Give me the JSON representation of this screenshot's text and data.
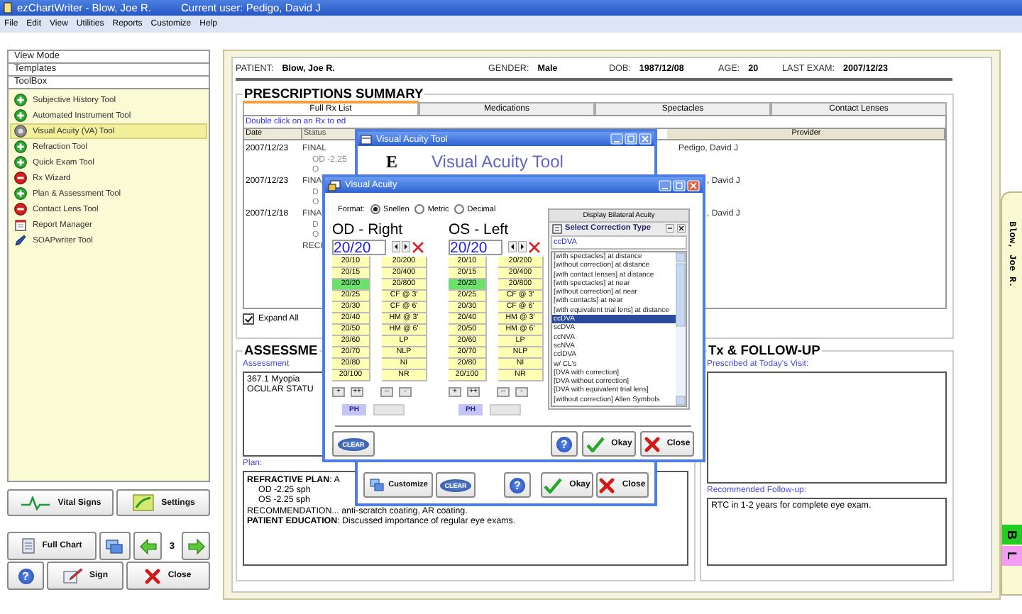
{
  "window": {
    "title": "ezChartWriter - Blow, Joe R.",
    "user": "Current user: Pedigo, David J"
  },
  "menu": [
    "File",
    "Edit",
    "View",
    "Utilities",
    "Reports",
    "Customize",
    "Help"
  ],
  "sidebar": {
    "sections": [
      "View Mode",
      "Templates",
      "ToolBox"
    ],
    "tools": [
      {
        "label": "Subjective History Tool",
        "kind": "green",
        "selected": false
      },
      {
        "label": "Automated Instrument Tool",
        "kind": "green",
        "selected": false
      },
      {
        "label": "Visual Acuity (VA) Tool",
        "kind": "grey",
        "selected": true
      },
      {
        "label": "Refraction Tool",
        "kind": "green",
        "selected": false
      },
      {
        "label": "Quick Exam Tool",
        "kind": "green",
        "selected": false
      },
      {
        "label": "Rx Wizard",
        "kind": "red",
        "selected": false
      },
      {
        "label": "Plan & Assessment Tool",
        "kind": "green",
        "selected": false
      },
      {
        "label": "Contact Lens Tool",
        "kind": "red",
        "selected": false
      },
      {
        "label": "Report Manager",
        "kind": "report",
        "selected": false
      },
      {
        "label": "SOAPwriter Tool",
        "kind": "writer",
        "selected": false
      }
    ]
  },
  "side_buttons": [
    [
      {
        "kind": "vitals",
        "label": "Vital Signs"
      },
      {
        "kind": "settings",
        "label": "Settings"
      }
    ],
    [
      {
        "kind": "chart",
        "label": "Full Chart"
      },
      {
        "kind": "windows"
      },
      {
        "kind": "prev"
      },
      {
        "kind": "page",
        "label": "3"
      },
      {
        "kind": "next"
      }
    ],
    [
      {
        "kind": "help",
        "label": "?"
      },
      {
        "kind": "sign",
        "label": "Sign"
      },
      {
        "kind": "close",
        "label": "Close"
      }
    ]
  ],
  "patient": [
    {
      "label": "PATIENT:",
      "value": "Blow, Joe R."
    },
    {
      "label": "GENDER:",
      "value": "Male"
    },
    {
      "label": "DOB:",
      "value": "1987/12/08"
    },
    {
      "label": "AGE:",
      "value": "20"
    },
    {
      "label": "LAST EXAM:",
      "value": "2007/12/23"
    }
  ],
  "prescriptions": {
    "title": "PRESCRIPTIONS SUMMARY",
    "tabs": [
      {
        "label": "Full Rx List",
        "selected": true
      },
      {
        "label": "Medications",
        "selected": false
      },
      {
        "label": "Spectacles",
        "selected": false
      },
      {
        "label": "Contact Lenses",
        "selected": false
      }
    ],
    "hint": "Double click on an Rx to ed",
    "columns": [
      "Date",
      "Status",
      "Provider"
    ],
    "rows": [
      {
        "date": "2007/12/23",
        "status": "FINAL",
        "details": [
          "OD -2.25",
          "O"
        ],
        "provider": "Pedigo, David J"
      },
      {
        "date": "2007/12/23",
        "status": "FINA",
        "details": [
          "D",
          "O"
        ],
        "provider": ", David J"
      },
      {
        "date": "2007/12/18",
        "status": "FINA",
        "details": [
          "D",
          "O"
        ],
        "note": "RECI",
        "provider": ", David J"
      }
    ],
    "expand_all": {
      "label": "Expand All",
      "checked": true
    }
  },
  "assessment": {
    "title": "ASSESSME",
    "label": "Assessment",
    "lines": [
      "367.1 Myopia",
      "OCULAR STATU"
    ],
    "plan_label": "Plan:",
    "plan": [
      "**REFRACTIVE PLAN**:  A",
      "OD -2.25  sph",
      "OS -2.25  sph",
      "RECOMMENDATION... anti-scratch coating, AR coating.",
      "**PATIENT EDUCATION**:  Discussed importance of regular eye exams."
    ]
  },
  "followup": {
    "title": "Tx & FOLLOW-UP",
    "prescribed_label": "Prescribed at Today's Visit:",
    "followup_label": "Recommended Follow-up:",
    "followup": "RTC in 1-2 years for complete eye exam."
  },
  "chart_tab": {
    "name": "Blow, Joe R.",
    "tags": [
      {
        "label": "B",
        "color": "#22cc22"
      },
      {
        "label": "L",
        "color": "#f49cf4"
      }
    ]
  },
  "va_tool": {
    "title": "Visual Acuity Tool",
    "logo": "E",
    "heading": "Visual Acuity Tool",
    "buttons": [
      {
        "kind": "customize",
        "label": "Customize"
      },
      {
        "kind": "clear",
        "label": "CLEAR"
      },
      {
        "kind": "help",
        "label": "?"
      },
      {
        "kind": "okay",
        "label": "Okay"
      },
      {
        "kind": "close",
        "label": "Close"
      }
    ]
  },
  "va": {
    "title": "Visual Acuity",
    "format_label": "Format:",
    "formats": [
      {
        "label": "Snellen",
        "selected": true
      },
      {
        "label": "Metric",
        "selected": false
      },
      {
        "label": "Decimal",
        "selected": false
      }
    ],
    "eyes": [
      {
        "title": "OD - Right",
        "value": "20/20",
        "cells": [
          {
            "label": "20/10",
            "selected": false
          },
          {
            "label": "20/15",
            "selected": false
          },
          {
            "label": "20/20",
            "selected": true
          },
          {
            "label": "20/25",
            "selected": false
          },
          {
            "label": "20/30",
            "selected": false
          },
          {
            "label": "20/40",
            "selected": false
          },
          {
            "label": "20/50",
            "selected": false
          },
          {
            "label": "20/60",
            "selected": false
          },
          {
            "label": "20/70",
            "selected": false
          },
          {
            "label": "20/80",
            "selected": false
          },
          {
            "label": "20/100",
            "selected": false
          },
          {
            "label": "20/200",
            "selected": false
          },
          {
            "label": "20/400",
            "selected": false
          },
          {
            "label": "20/800",
            "selected": false
          },
          {
            "label": "CF @ 3'",
            "selected": false
          },
          {
            "label": "CF @ 6'",
            "selected": false
          },
          {
            "label": "HM @ 3'",
            "selected": false
          },
          {
            "label": "HM @ 6'",
            "selected": false
          },
          {
            "label": "LP",
            "selected": false
          },
          {
            "label": "NLP",
            "selected": false
          },
          {
            "label": "NI",
            "selected": false
          },
          {
            "label": "NR",
            "selected": false
          }
        ],
        "steps": [
          "+",
          "++",
          "--",
          "-"
        ],
        "ph": "PH"
      },
      {
        "title": "OS - Left",
        "value": "20/20",
        "cells": [
          {
            "label": "20/10",
            "selected": false
          },
          {
            "label": "20/15",
            "selected": false
          },
          {
            "label": "20/20",
            "selected": true
          },
          {
            "label": "20/25",
            "selected": false
          },
          {
            "label": "20/30",
            "selected": false
          },
          {
            "label": "20/40",
            "selected": false
          },
          {
            "label": "20/50",
            "selected": false
          },
          {
            "label": "20/60",
            "selected": false
          },
          {
            "label": "20/70",
            "selected": false
          },
          {
            "label": "20/80",
            "selected": false
          },
          {
            "label": "20/100",
            "selected": false
          },
          {
            "label": "20/200",
            "selected": false
          },
          {
            "label": "20/400",
            "selected": false
          },
          {
            "label": "20/800",
            "selected": false
          },
          {
            "label": "CF @ 3'",
            "selected": false
          },
          {
            "label": "CF @ 6'",
            "selected": false
          },
          {
            "label": "HM @ 3'",
            "selected": false
          },
          {
            "label": "HM @ 6'",
            "selected": false
          },
          {
            "label": "LP",
            "selected": false
          },
          {
            "label": "NLP",
            "selected": false
          },
          {
            "label": "NI",
            "selected": false
          },
          {
            "label": "NR",
            "selected": false
          }
        ],
        "steps": [
          "+",
          "++",
          "--",
          "-"
        ],
        "ph": "PH"
      }
    ],
    "bilateral": "Display Bilateral Acuity",
    "correction_title": "Select Correction Type",
    "correction_value": "ccDVA",
    "corrections": [
      {
        "label": "[with spectacles] at distance",
        "selected": false
      },
      {
        "label": "[without correction] at distance",
        "selected": false
      },
      {
        "label": "[with contact lenses] at distance",
        "selected": false
      },
      {
        "label": "[with spectacles] at near",
        "selected": false
      },
      {
        "label": "[without correction] at near",
        "selected": false
      },
      {
        "label": "[with contacts] at near",
        "selected": false
      },
      {
        "label": "[with equivalent trial lens] at distance",
        "selected": false
      },
      {
        "label": "ccDVA",
        "selected": true
      },
      {
        "label": "scDVA",
        "selected": false
      },
      {
        "label": "ccNVA",
        "selected": false
      },
      {
        "label": "scNVA",
        "selected": false
      },
      {
        "label": "cclDVA",
        "selected": false
      },
      {
        "label": "w/ CL's",
        "selected": false
      },
      {
        "label": "[DVA with correction]",
        "selected": false
      },
      {
        "label": "[DVA without correction]",
        "selected": false
      },
      {
        "label": "[DVA with equivalent trial lens]",
        "selected": false
      },
      {
        "label": "[without correction] Allen Symbols",
        "selected": false
      }
    ],
    "buttons": [
      {
        "kind": "clear",
        "label": "CLEAR"
      },
      {
        "kind": "help",
        "label": "?"
      },
      {
        "kind": "okay",
        "label": "Okay"
      },
      {
        "kind": "close",
        "label": "Close"
      }
    ]
  }
}
